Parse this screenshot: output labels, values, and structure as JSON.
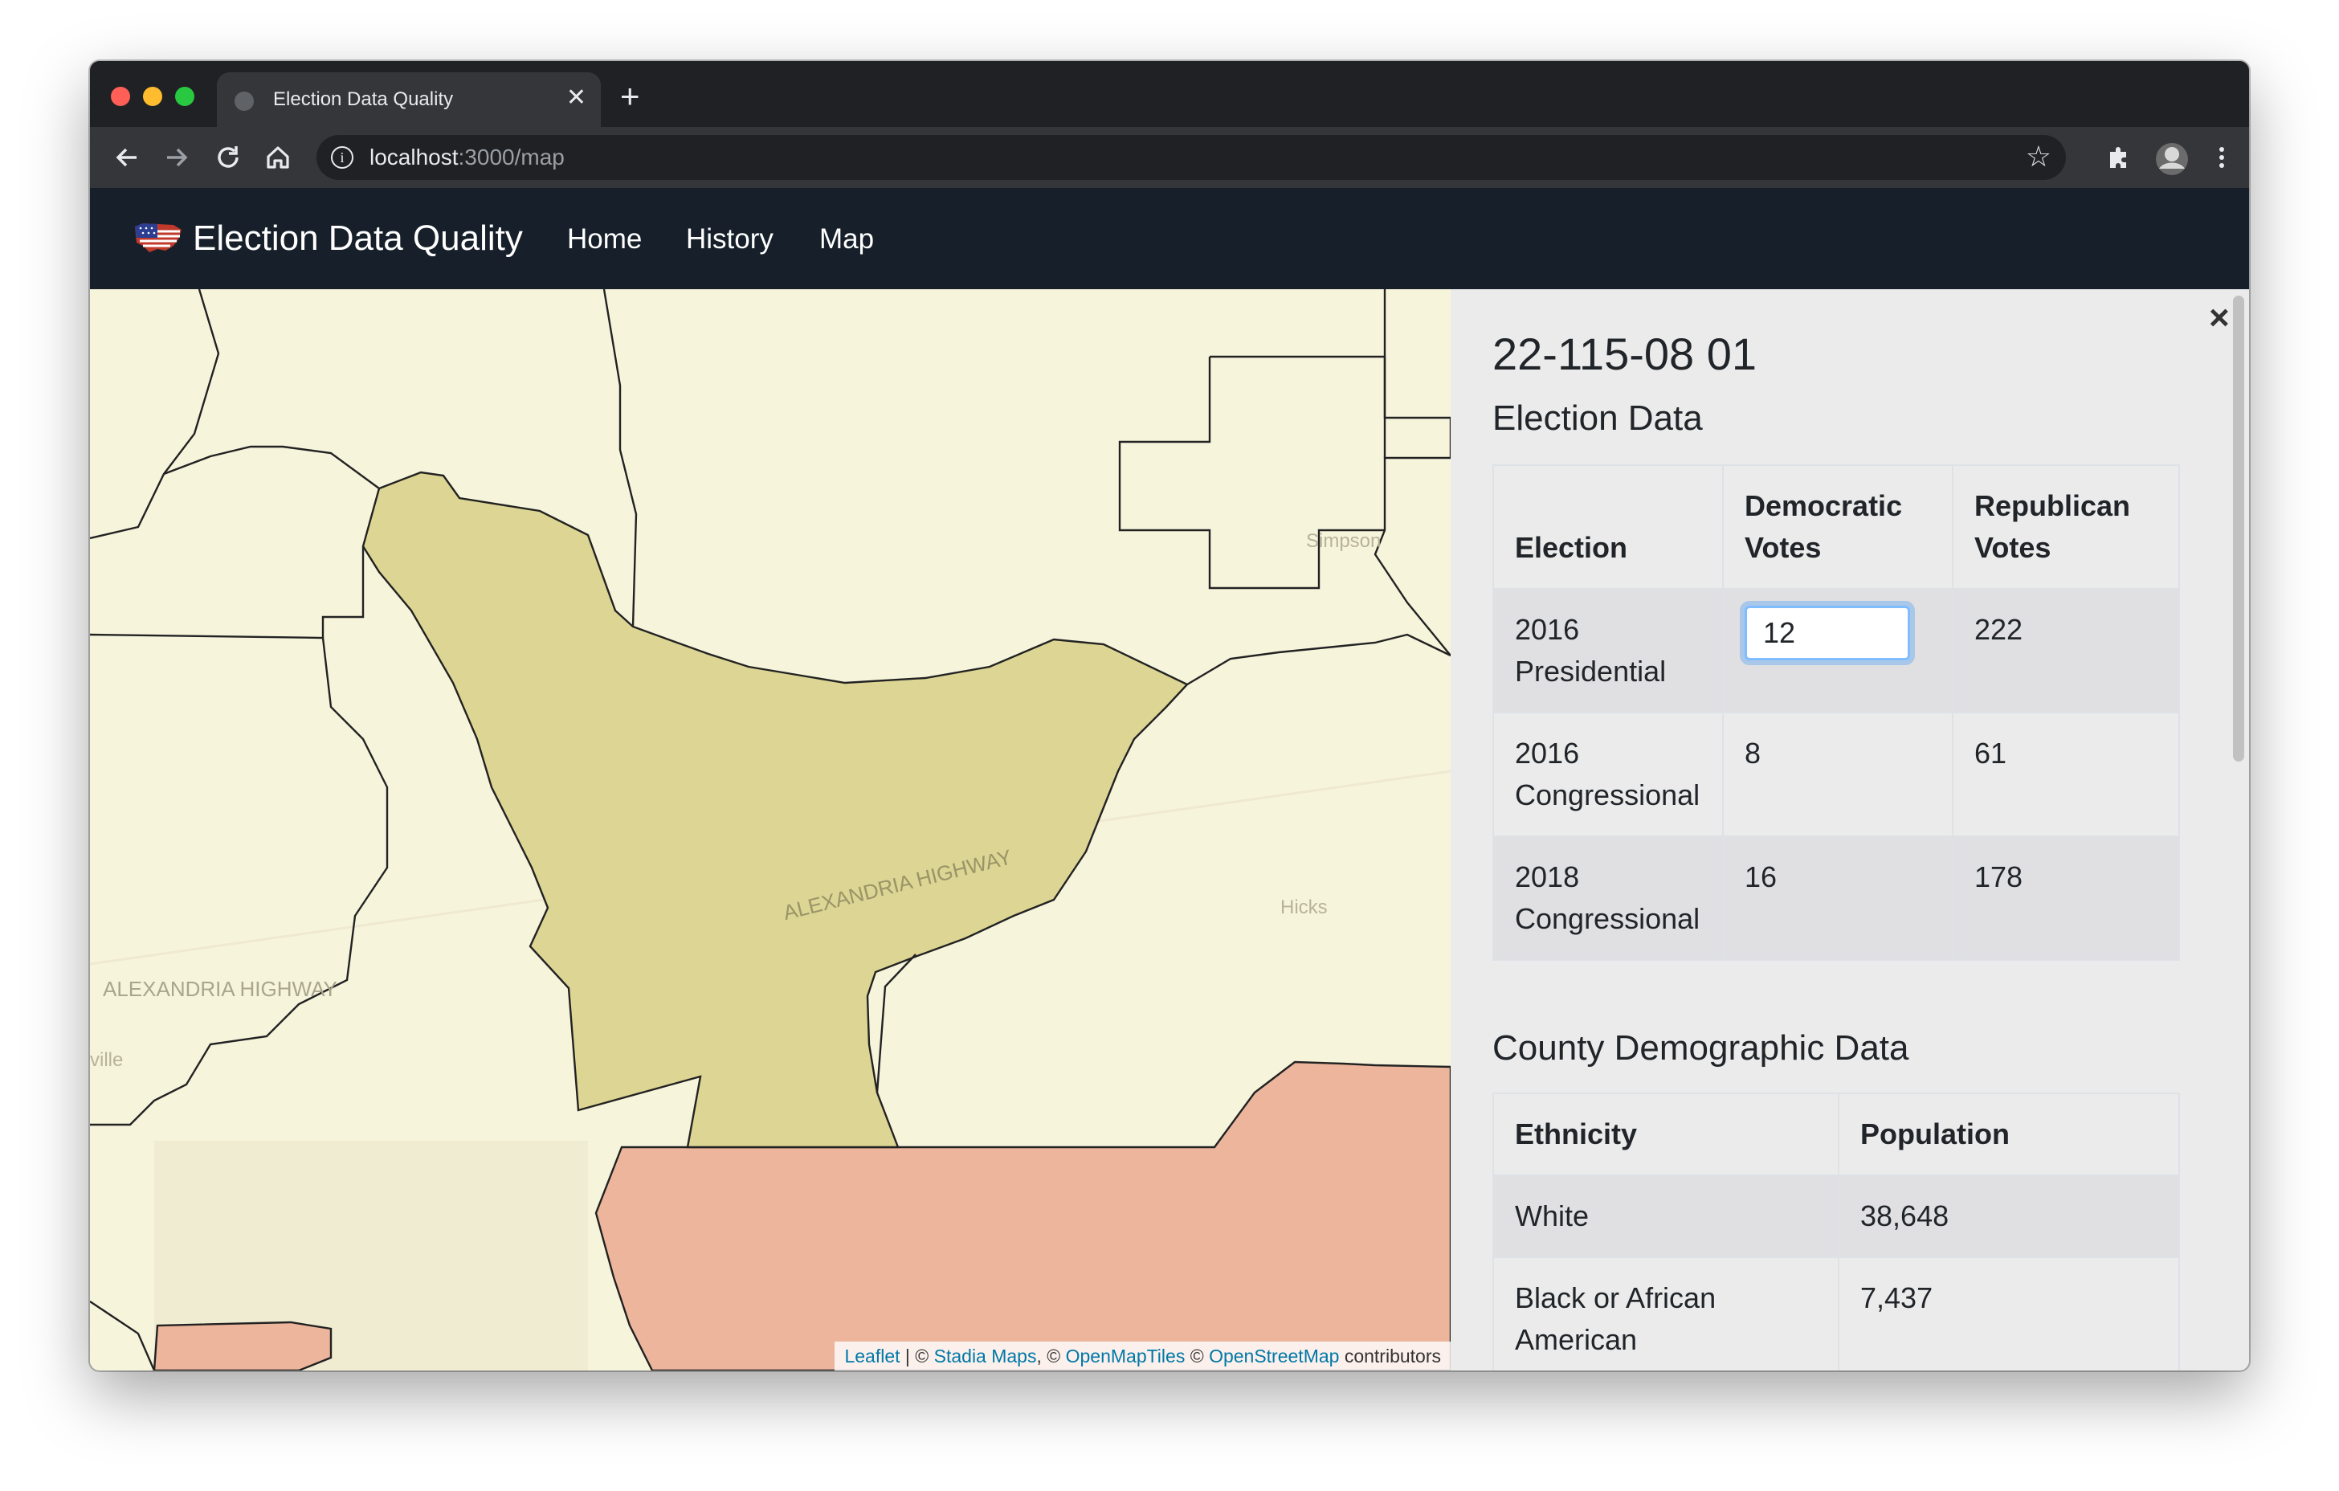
{
  "browser": {
    "tab_title": "Election Data Quality",
    "url_host": "localhost",
    "url_rest": ":3000/map"
  },
  "navbar": {
    "brand": "Election Data Quality",
    "links": [
      "Home",
      "History",
      "Map"
    ]
  },
  "map": {
    "labels": {
      "simpson": "Simpson",
      "hicks": "Hicks",
      "road_center": "ALEXANDRIA HIGHWAY",
      "road_left": "ALEXANDRIA HIGHWAY",
      "ville": "ville"
    },
    "attribution": {
      "leaflet": "Leaflet",
      "sep1": "| ©",
      "stadia": "Stadia Maps",
      "sep2": ", ©",
      "openmaptiles": "OpenMapTiles",
      "sep3": "©",
      "osm": "OpenStreetMap",
      "tail": "contributors"
    }
  },
  "panel": {
    "close_symbol": "×",
    "precinct_id": "22-115-08 01",
    "election_title": "Election Data",
    "election_headers": [
      "Election",
      "Democratic Votes",
      "Republican Votes"
    ],
    "elections": [
      {
        "name": "2016 Presidential",
        "dem": "12",
        "rep": "222"
      },
      {
        "name": "2016 Congressional",
        "dem": "8",
        "rep": "61"
      },
      {
        "name": "2018 Congressional",
        "dem": "16",
        "rep": "178"
      }
    ],
    "demo_title": "County Demographic Data",
    "demo_headers": [
      "Ethnicity",
      "Population"
    ],
    "demographics": [
      {
        "ethnicity": "White",
        "population": "38,648"
      },
      {
        "ethnicity": "Black or African American",
        "population": "7,437"
      }
    ]
  }
}
